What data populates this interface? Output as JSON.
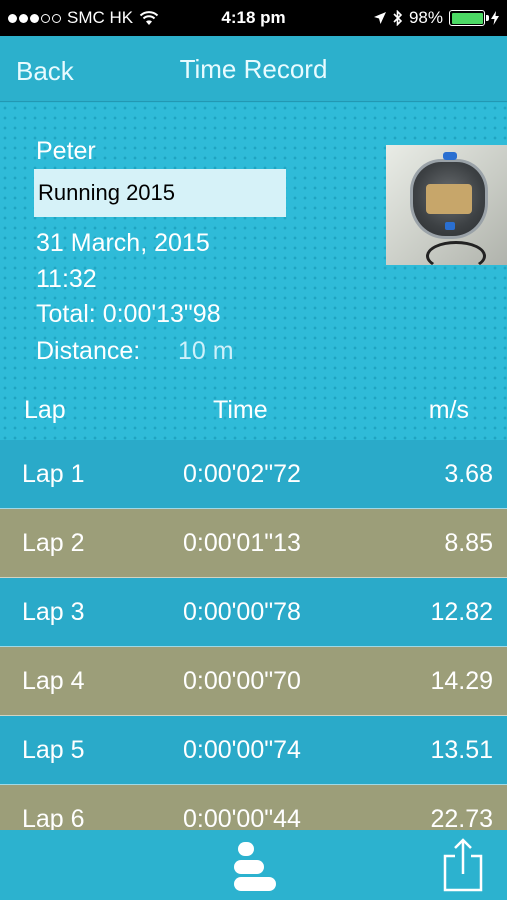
{
  "status_bar": {
    "carrier": "SMC HK",
    "time": "4:18 pm",
    "battery_percent": "98%",
    "signal_bars_filled": 3,
    "signal_bars_total": 5,
    "battery_color": "#4cd964"
  },
  "nav": {
    "back_label": "Back",
    "title": "Time Record"
  },
  "record": {
    "name": "Peter",
    "event": "Running 2015",
    "date": "31 March, 2015",
    "time": "11:32",
    "total": "Total: 0:00'13\"98",
    "distance_label": "Distance:",
    "distance_value": "10 m"
  },
  "table": {
    "headers": {
      "lap": "Lap",
      "time": "Time",
      "speed": "m/s"
    },
    "rows": [
      {
        "lap": "Lap 1",
        "time": "0:00'02\"72",
        "speed": "3.68",
        "color": "#2aaac9"
      },
      {
        "lap": "Lap 2",
        "time": "0:00'01\"13",
        "speed": "8.85",
        "color": "#9c9e79"
      },
      {
        "lap": "Lap 3",
        "time": "0:00'00\"78",
        "speed": "12.82",
        "color": "#2aaac9"
      },
      {
        "lap": "Lap 4",
        "time": "0:00'00\"70",
        "speed": "14.29",
        "color": "#9c9e79"
      },
      {
        "lap": "Lap 5",
        "time": "0:00'00\"74",
        "speed": "13.51",
        "color": "#2aaac9"
      },
      {
        "lap": "Lap 6",
        "time": "0:00'00\"44",
        "speed": "22.73",
        "color": "#9c9e79"
      }
    ]
  },
  "toolbar": {
    "stats_icon": "bar-stats-icon",
    "share_icon": "share-icon"
  },
  "colors": {
    "accent": "#2bb7d4",
    "row_blue": "#2aaac9",
    "row_olive": "#9c9e79"
  }
}
